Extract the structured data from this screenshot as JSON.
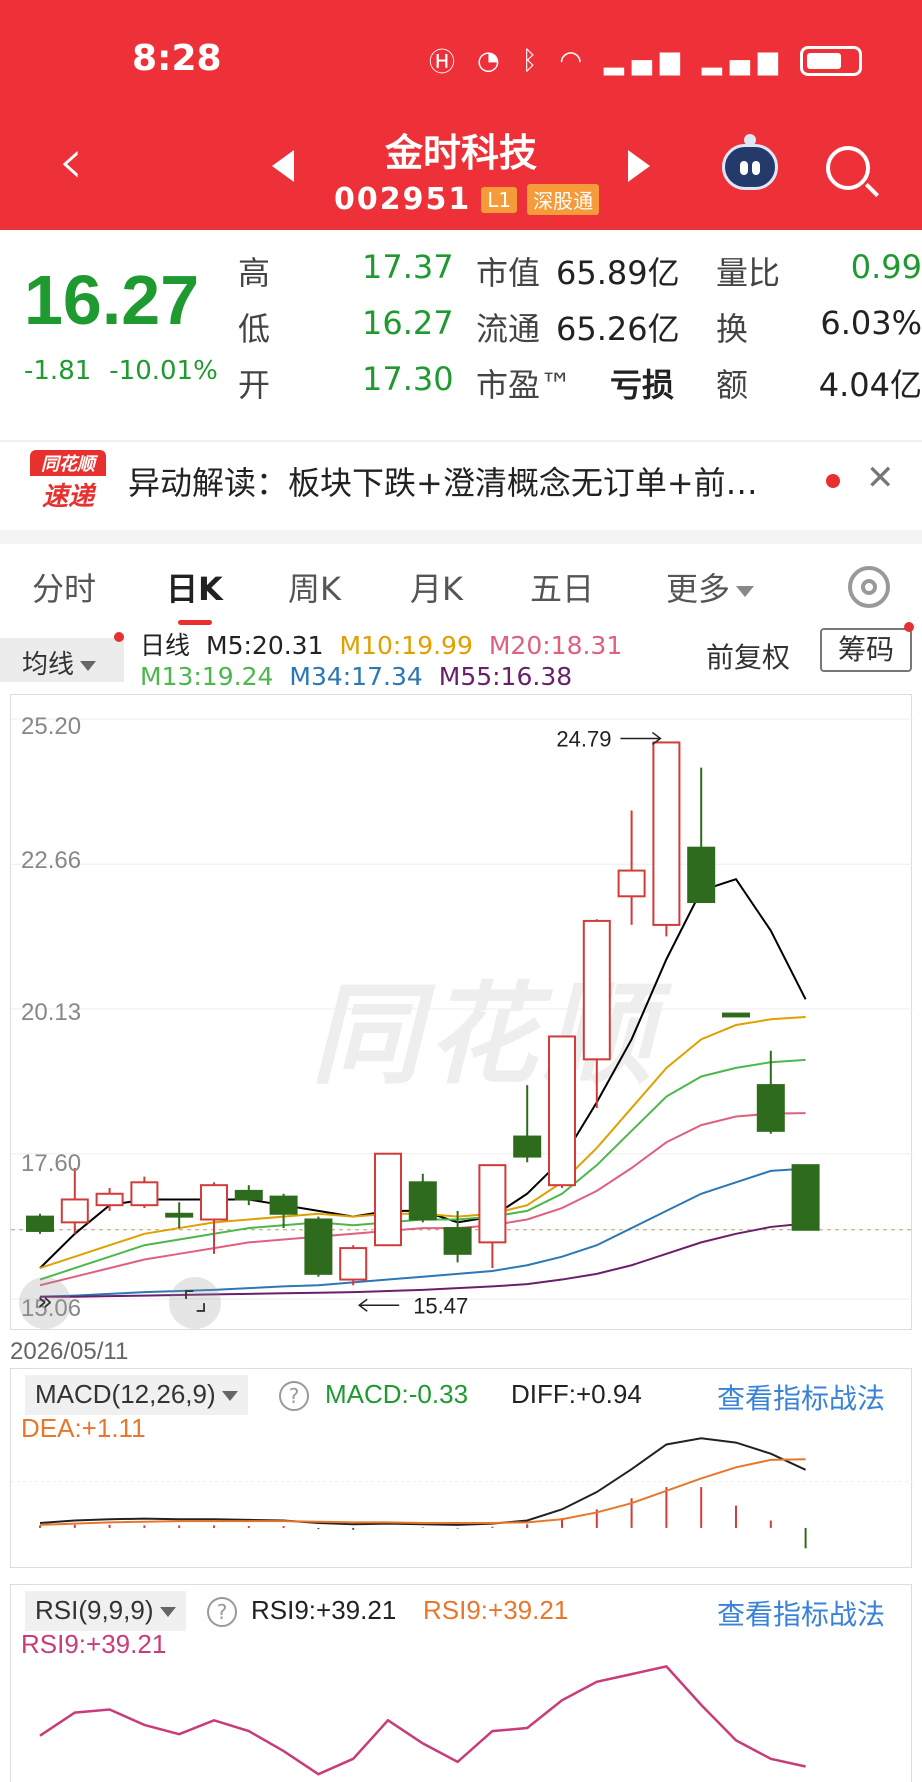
{
  "status": {
    "time": "8:28",
    "icons": [
      "hd-icon",
      "speed-icon",
      "bluetooth-icon",
      "wifi-icon",
      "4g-signal-icon",
      "4g-signal-icon",
      "battery-icon"
    ]
  },
  "header": {
    "name": "金时科技",
    "code": "002951",
    "tag1": "L1",
    "tag2": "深股通"
  },
  "quote": {
    "price": "16.27",
    "change": "-1.81",
    "change_pct": "-10.01%",
    "rows": [
      {
        "l1": "高",
        "v1": "17.37",
        "l2": "市值",
        "v2": "65.89亿",
        "l3": "量比",
        "v3": "0.99"
      },
      {
        "l1": "低",
        "v1": "16.27",
        "l2": "流通",
        "v2": "65.26亿",
        "l3": "换",
        "v3": "6.03%"
      },
      {
        "l1": "开",
        "v1": "17.30",
        "l2": "市盈™",
        "v2": "亏损",
        "l3": "额",
        "v3": "4.04亿"
      }
    ]
  },
  "news": {
    "logo_top": "同花顺",
    "logo_bottom": "速递",
    "text": "异动解读：板块下跌+澄清概念无订单+前…"
  },
  "tabs": [
    "分时",
    "日K",
    "周K",
    "月K",
    "五日",
    "更多"
  ],
  "legend": {
    "ma_button": "均线",
    "daily": "日线",
    "m5": "M5:20.31",
    "m10": "M10:19.99",
    "m20": "M20:18.31",
    "m13": "M13:19.24",
    "m34": "M34:17.34",
    "m55": "M55:16.38",
    "fuquan": "前复权",
    "chouma": "筹码"
  },
  "kchart": {
    "watermark": "同花顺",
    "date": "2026/05/11",
    "yticks": [
      "25.20",
      "22.66",
      "20.13",
      "17.60",
      "15.06"
    ],
    "high_label": "24.79",
    "low_label": "15.47",
    "expand_icon": "»",
    "fullscreen_icon": "⌜⌟"
  },
  "macd": {
    "name": "MACD(12,26,9)",
    "macd": "MACD:-0.33",
    "diff": "DIFF:+0.94",
    "dea": "DEA:+1.11",
    "link": "查看指标战法"
  },
  "rsi": {
    "name": "RSI(9,9,9)",
    "v1": "RSI9:+39.21",
    "v2": "RSI9:+39.21",
    "v3": "RSI9:+39.21",
    "link": "查看指标战法"
  },
  "colors": {
    "up": "#d33a3a",
    "down": "#2e6b1c",
    "header": "#ee3038",
    "m5": "#000000",
    "m10": "#e0a000",
    "m20": "#e06080",
    "m13": "#4cb84c",
    "m34": "#2b78b5",
    "m55": "#6a1f6a"
  },
  "chart_data": [
    {
      "type": "candlestick",
      "yticks": [
        25.2,
        22.66,
        20.13,
        17.6,
        15.06
      ],
      "ylim": [
        15.06,
        25.2
      ],
      "candles": [
        {
          "o": 16.5,
          "c": 16.25,
          "h": 16.55,
          "l": 16.2
        },
        {
          "o": 16.4,
          "c": 16.8,
          "h": 17.35,
          "l": 16.2
        },
        {
          "o": 16.7,
          "c": 16.9,
          "h": 17.0,
          "l": 16.6
        },
        {
          "o": 16.7,
          "c": 17.1,
          "h": 17.2,
          "l": 16.65
        },
        {
          "o": 16.55,
          "c": 16.5,
          "h": 16.75,
          "l": 16.3
        },
        {
          "o": 16.45,
          "c": 17.05,
          "h": 17.1,
          "l": 15.85
        },
        {
          "o": 16.95,
          "c": 16.8,
          "h": 17.05,
          "l": 16.7
        },
        {
          "o": 16.85,
          "c": 16.55,
          "h": 16.9,
          "l": 16.3
        },
        {
          "o": 16.45,
          "c": 15.5,
          "h": 16.5,
          "l": 15.45
        },
        {
          "o": 15.4,
          "c": 15.95,
          "h": 16.0,
          "l": 15.3
        },
        {
          "o": 16.0,
          "c": 17.6,
          "h": 17.6,
          "l": 16.0
        },
        {
          "o": 17.1,
          "c": 16.45,
          "h": 17.25,
          "l": 16.4
        },
        {
          "o": 16.3,
          "c": 15.85,
          "h": 16.6,
          "l": 15.7
        },
        {
          "o": 16.05,
          "c": 17.4,
          "h": 17.4,
          "l": 15.6
        },
        {
          "o": 17.9,
          "c": 17.55,
          "h": 18.8,
          "l": 17.45
        },
        {
          "o": 17.05,
          "c": 19.65,
          "h": 19.65,
          "l": 17.0
        },
        {
          "o": 19.25,
          "c": 21.67,
          "h": 21.7,
          "l": 18.4
        },
        {
          "o": 22.1,
          "c": 22.55,
          "h": 23.6,
          "l": 21.6
        },
        {
          "o": 21.6,
          "c": 24.79,
          "h": 24.79,
          "l": 21.4
        },
        {
          "o": 22.95,
          "c": 22.0,
          "h": 24.35,
          "l": 22.0
        },
        {
          "o": 20.05,
          "c": 20.0,
          "h": 20.05,
          "l": 20.0
        },
        {
          "o": 18.8,
          "c": 18.0,
          "h": 19.4,
          "l": 17.95
        },
        {
          "o": 17.4,
          "c": 16.27,
          "h": 17.37,
          "l": 16.27
        }
      ],
      "ma": {
        "M5": [
          15.6,
          16.2,
          16.7,
          16.8,
          16.8,
          16.8,
          16.8,
          16.7,
          16.6,
          16.5,
          16.6,
          16.6,
          16.4,
          16.5,
          16.9,
          17.5,
          18.5,
          19.6,
          21.0,
          22.2,
          22.4,
          21.5,
          20.3
        ],
        "M10": [
          15.6,
          15.8,
          16.0,
          16.2,
          16.3,
          16.4,
          16.45,
          16.5,
          16.55,
          16.5,
          16.55,
          16.55,
          16.5,
          16.55,
          16.7,
          17.1,
          17.7,
          18.4,
          19.1,
          19.6,
          19.85,
          19.95,
          19.99
        ],
        "M13": [
          15.4,
          15.6,
          15.8,
          16.0,
          16.1,
          16.2,
          16.3,
          16.35,
          16.4,
          16.35,
          16.4,
          16.45,
          16.45,
          16.5,
          16.6,
          16.9,
          17.4,
          18.0,
          18.6,
          18.95,
          19.1,
          19.2,
          19.24
        ],
        "M20": [
          15.3,
          15.45,
          15.6,
          15.75,
          15.85,
          15.95,
          16.05,
          16.1,
          16.15,
          16.2,
          16.25,
          16.3,
          16.3,
          16.35,
          16.45,
          16.65,
          16.95,
          17.35,
          17.8,
          18.1,
          18.25,
          18.3,
          18.31
        ],
        "M34": [
          15.1,
          15.12,
          15.15,
          15.18,
          15.2,
          15.22,
          15.25,
          15.28,
          15.3,
          15.35,
          15.4,
          15.45,
          15.5,
          15.55,
          15.65,
          15.8,
          16.0,
          16.3,
          16.6,
          16.9,
          17.1,
          17.3,
          17.34
        ],
        "M55": [
          15.1,
          15.1,
          15.11,
          15.12,
          15.13,
          15.14,
          15.15,
          15.16,
          15.17,
          15.18,
          15.2,
          15.22,
          15.25,
          15.28,
          15.32,
          15.4,
          15.5,
          15.65,
          15.85,
          16.05,
          16.2,
          16.32,
          16.38
        ]
      }
    },
    {
      "type": "bar",
      "name": "MACD",
      "values": [
        0.04,
        0.05,
        0.05,
        0.04,
        0.04,
        0.04,
        0.03,
        0.03,
        -0.02,
        -0.03,
        0.0,
        0.01,
        -0.01,
        0.02,
        0.06,
        0.16,
        0.3,
        0.48,
        0.66,
        0.66,
        0.36,
        0.12,
        -0.33
      ],
      "series": [
        {
          "name": "DIFF",
          "values": [
            0.08,
            0.12,
            0.14,
            0.15,
            0.14,
            0.14,
            0.13,
            0.12,
            0.08,
            0.06,
            0.07,
            0.06,
            0.05,
            0.07,
            0.12,
            0.3,
            0.58,
            0.95,
            1.35,
            1.45,
            1.38,
            1.2,
            0.94
          ]
        },
        {
          "name": "DEA",
          "values": [
            0.05,
            0.07,
            0.09,
            0.1,
            0.11,
            0.11,
            0.11,
            0.11,
            0.1,
            0.09,
            0.09,
            0.08,
            0.08,
            0.08,
            0.09,
            0.14,
            0.25,
            0.4,
            0.6,
            0.8,
            0.98,
            1.1,
            1.11
          ]
        }
      ]
    },
    {
      "type": "line",
      "name": "RSI",
      "series": [
        {
          "name": "RSI9",
          "values": [
            45,
            60,
            62,
            52,
            46,
            55,
            48,
            35,
            20,
            30,
            55,
            40,
            28,
            48,
            50,
            68,
            80,
            85,
            90,
            65,
            42,
            30,
            25
          ]
        }
      ]
    }
  ]
}
